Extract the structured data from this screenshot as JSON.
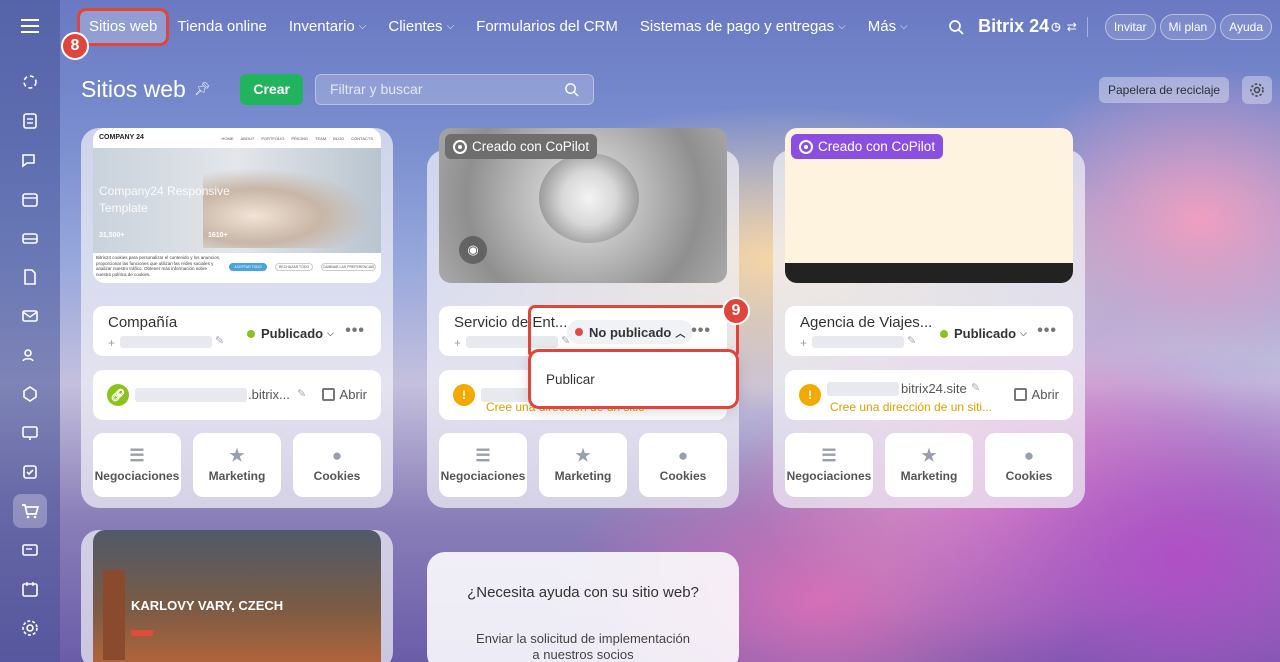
{
  "nav": {
    "items": [
      {
        "label": "Sitios web",
        "dropdown": false
      },
      {
        "label": "Tienda online",
        "dropdown": false
      },
      {
        "label": "Inventario",
        "dropdown": true
      },
      {
        "label": "Clientes",
        "dropdown": true
      },
      {
        "label": "Formularios del CRM",
        "dropdown": false
      },
      {
        "label": "Sistemas de pago y entregas",
        "dropdown": true
      },
      {
        "label": "Más",
        "dropdown": true
      }
    ],
    "logo": "Bitrix 24",
    "invite": "Invitar",
    "plan": "Mi plan",
    "help": "Ayuda"
  },
  "callouts": {
    "first": "8",
    "second": "9"
  },
  "page": {
    "title": "Sitios web",
    "create": "Crear",
    "search_placeholder": "Filtrar y buscar",
    "trash": "Papelera de reciclaje"
  },
  "cards": [
    {
      "name": "Compañía",
      "status": "Publicado",
      "status_color": "#8bc21c",
      "domain": ".bitrix...",
      "open": "Abrir",
      "thumb": {
        "company": "COMPANY 24",
        "menu": [
          "HOME",
          "ABOUT",
          "PORTFOLIO",
          "PRICING",
          "TEAM",
          "BLOG",
          "CONTACTS"
        ],
        "headline": "Company24 Responsive Template",
        "stat1": "31,500+",
        "stat2": "1610+",
        "cookie": "Bitrix24 cookies para personalizar el contenido y los anuncios, proporcionar las funciones que utilizan las redes sociales y analizar nuestro tráfico. Obtener más información sobre nuestra política de cookies.",
        "btn1": "ACEPTAR TODO",
        "btn2": "RECHAZAR TODO",
        "btn3": "CAMBIAR LAS PREFERENCIAS"
      }
    },
    {
      "name": "Servicio de Ent...",
      "status": "No publicado",
      "status_color": "#e24b4b",
      "copilot": "Creado con CoPilot",
      "warn": "Cree una dirección de un sitio"
    },
    {
      "name": "Agencia de Viajes...",
      "status": "Publicado",
      "status_color": "#8bc21c",
      "copilot": "Creado con CoPilot",
      "domain": "bitrix24.site",
      "open": "Abrir",
      "warn": "Cree una dirección de un siti..."
    }
  ],
  "tiles": [
    "Negociaciones",
    "Marketing",
    "Cookies"
  ],
  "dropdown": {
    "option": "Publicar"
  },
  "bottom": {
    "city": "KARLOVY VARY, CZECH",
    "help_title": "¿Necesita ayuda con su sitio web?",
    "help_text_1": "Enviar la solicitud de implementación",
    "help_text_2": "a nuestros socios"
  },
  "colors": {
    "accent_red": "#e0453c",
    "green": "#22b35f",
    "copilot_purple": "#8a4fe0"
  }
}
